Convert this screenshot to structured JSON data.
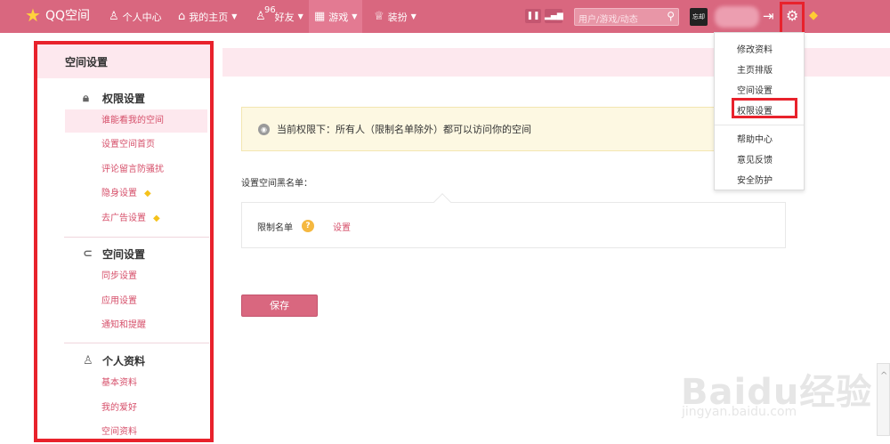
{
  "topbar": {
    "logo_text": "QQ空间",
    "nav": [
      {
        "label": "个人中心",
        "icon": "person-icon"
      },
      {
        "label": "我的主页",
        "icon": "home-icon"
      },
      {
        "label": "好友",
        "icon": "friends-icon",
        "badge": "96"
      },
      {
        "label": "游戏",
        "icon": "grid-icon"
      },
      {
        "label": "装扮",
        "icon": "tshirt-icon"
      }
    ],
    "search_placeholder": "用户/游戏/动态",
    "avatar_text": "忘却"
  },
  "sidebar": {
    "title": "空间设置",
    "groups": [
      {
        "label": "权限设置",
        "items": [
          "谁能看我的空间",
          "设置空间首页",
          "评论留言防骚扰",
          "隐身设置",
          "去广告设置"
        ]
      },
      {
        "label": "空间设置",
        "items": [
          "同步设置",
          "应用设置",
          "通知和提醒"
        ]
      },
      {
        "label": "个人资料",
        "items": [
          "基本资料",
          "我的爱好",
          "空间资料"
        ]
      }
    ]
  },
  "main": {
    "notice": "当前权限下：所有人（限制名单除外）都可以访问你的空间",
    "blacklist_label": "设置空间黑名单：",
    "restrict_label": "限制名单",
    "restrict_link": "设置",
    "save_label": "保存"
  },
  "dropdown": {
    "items": [
      "修改资料",
      "主页排版",
      "空间设置",
      "权限设置",
      "帮助中心",
      "意见反馈",
      "安全防护"
    ]
  },
  "watermark": {
    "main": "Baidu经验",
    "sub": "jingyan.baidu.com"
  },
  "colors": {
    "brand": "#d9677f",
    "accent_text": "#d64f6a",
    "highlight_box": "#e8222c"
  }
}
